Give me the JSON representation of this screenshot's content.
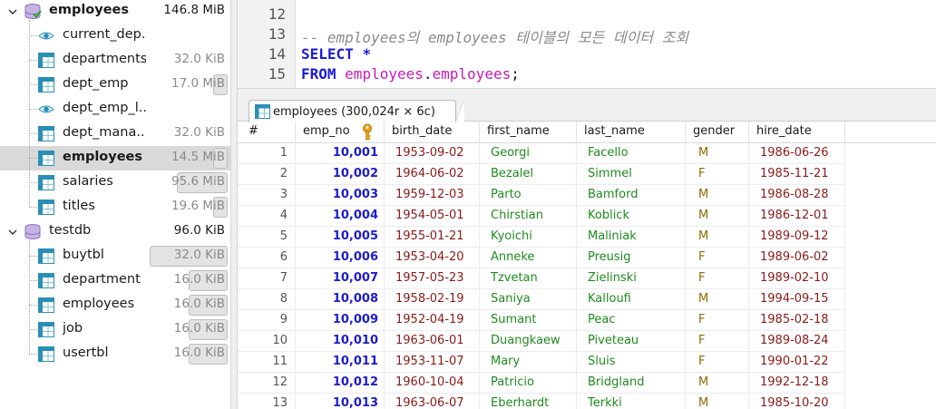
{
  "tree": {
    "databases": [
      {
        "name": "employees",
        "size": "146.8 MiB",
        "expanded": true,
        "tables": [
          {
            "name": "current_dep...",
            "size": "",
            "kind": "view",
            "fill": 0
          },
          {
            "name": "departments",
            "size": "32.0 KiB",
            "kind": "table",
            "fill": 0
          },
          {
            "name": "dept_emp",
            "size": "17.0 MiB",
            "kind": "table",
            "fill": 0.12
          },
          {
            "name": "dept_emp_l...",
            "size": "",
            "kind": "view",
            "fill": 0
          },
          {
            "name": "dept_mana...",
            "size": "32.0 KiB",
            "kind": "table",
            "fill": 0
          },
          {
            "name": "employees",
            "size": "14.5 MiB",
            "kind": "table",
            "fill": 0.1,
            "selected": true
          },
          {
            "name": "salaries",
            "size": "95.6 MiB",
            "kind": "table",
            "fill": 0.65
          },
          {
            "name": "titles",
            "size": "19.6 MiB",
            "kind": "table",
            "fill": 0.14
          }
        ]
      },
      {
        "name": "testdb",
        "size": "96.0 KiB",
        "expanded": true,
        "tables": [
          {
            "name": "buytbl",
            "size": "32.0 KiB",
            "kind": "table",
            "fill": 1.0
          },
          {
            "name": "department",
            "size": "16.0 KiB",
            "kind": "table",
            "fill": 0.5
          },
          {
            "name": "employees",
            "size": "16.0 KiB",
            "kind": "table",
            "fill": 0.5
          },
          {
            "name": "job",
            "size": "16.0 KiB",
            "kind": "table",
            "fill": 0.5
          },
          {
            "name": "usertbl",
            "size": "16.0 KiB",
            "kind": "table",
            "fill": 0.5
          }
        ]
      }
    ]
  },
  "editor": {
    "lines": [
      {
        "no": "12",
        "tokens": []
      },
      {
        "no": "13",
        "tokens": [
          {
            "t": "-- employees의 employees 테이블의 모든 데이터 조회",
            "c": "cmt"
          }
        ]
      },
      {
        "no": "14",
        "tokens": [
          {
            "t": "SELECT",
            "c": "kw"
          },
          {
            "t": " ",
            "c": "pun"
          },
          {
            "t": "*",
            "c": "kw"
          }
        ]
      },
      {
        "no": "15",
        "tokens": [
          {
            "t": "FROM",
            "c": "kw"
          },
          {
            "t": " ",
            "c": "pun"
          },
          {
            "t": "employees",
            "c": "ident"
          },
          {
            "t": ".",
            "c": "pun"
          },
          {
            "t": "employees",
            "c": "ident"
          },
          {
            "t": ";",
            "c": "pun"
          }
        ]
      }
    ]
  },
  "result_tab": {
    "label": "employees (300,024r × 6c)"
  },
  "grid": {
    "columns": [
      "#",
      "emp_no",
      "birth_date",
      "first_name",
      "last_name",
      "gender",
      "hire_date"
    ],
    "rows": [
      [
        "1",
        "10,001",
        "1953-09-02",
        "Georgi",
        "Facello",
        "M",
        "1986-06-26"
      ],
      [
        "2",
        "10,002",
        "1964-06-02",
        "Bezalel",
        "Simmel",
        "F",
        "1985-11-21"
      ],
      [
        "3",
        "10,003",
        "1959-12-03",
        "Parto",
        "Bamford",
        "M",
        "1986-08-28"
      ],
      [
        "4",
        "10,004",
        "1954-05-01",
        "Chirstian",
        "Koblick",
        "M",
        "1986-12-01"
      ],
      [
        "5",
        "10,005",
        "1955-01-21",
        "Kyoichi",
        "Maliniak",
        "M",
        "1989-09-12"
      ],
      [
        "6",
        "10,006",
        "1953-04-20",
        "Anneke",
        "Preusig",
        "F",
        "1989-06-02"
      ],
      [
        "7",
        "10,007",
        "1957-05-23",
        "Tzvetan",
        "Zielinski",
        "F",
        "1989-02-10"
      ],
      [
        "8",
        "10,008",
        "1958-02-19",
        "Saniya",
        "Kalloufi",
        "M",
        "1994-09-15"
      ],
      [
        "9",
        "10,009",
        "1952-04-19",
        "Sumant",
        "Peac",
        "F",
        "1985-02-18"
      ],
      [
        "10",
        "10,010",
        "1963-06-01",
        "Duangkaew",
        "Piveteau",
        "F",
        "1989-08-24"
      ],
      [
        "11",
        "10,011",
        "1953-11-07",
        "Mary",
        "Sluis",
        "F",
        "1990-01-22"
      ],
      [
        "12",
        "10,012",
        "1960-10-04",
        "Patricio",
        "Bridgland",
        "M",
        "1992-12-18"
      ],
      [
        "13",
        "10,013",
        "1963-06-07",
        "Eberhardt",
        "Terkki",
        "M",
        "1985-10-20"
      ]
    ]
  },
  "colors": {
    "selection": "#d9d9d9",
    "keyword": "#1b1bd6",
    "identifier": "#c81ab7",
    "comment": "#8a8a8a",
    "emp_no": "#1c1ccc",
    "date": "#8b1a1a",
    "text": "#1f8a1f",
    "gender": "#8a6d00",
    "key_icon": "#e8a317",
    "db_icon": "#b8a2d9",
    "table_icon": "#2a8fb5"
  },
  "icons": {
    "database": "database-icon",
    "table": "table-icon",
    "view": "view-eye-icon",
    "primary_key": "key-icon",
    "expand": "chevron-down-icon"
  }
}
